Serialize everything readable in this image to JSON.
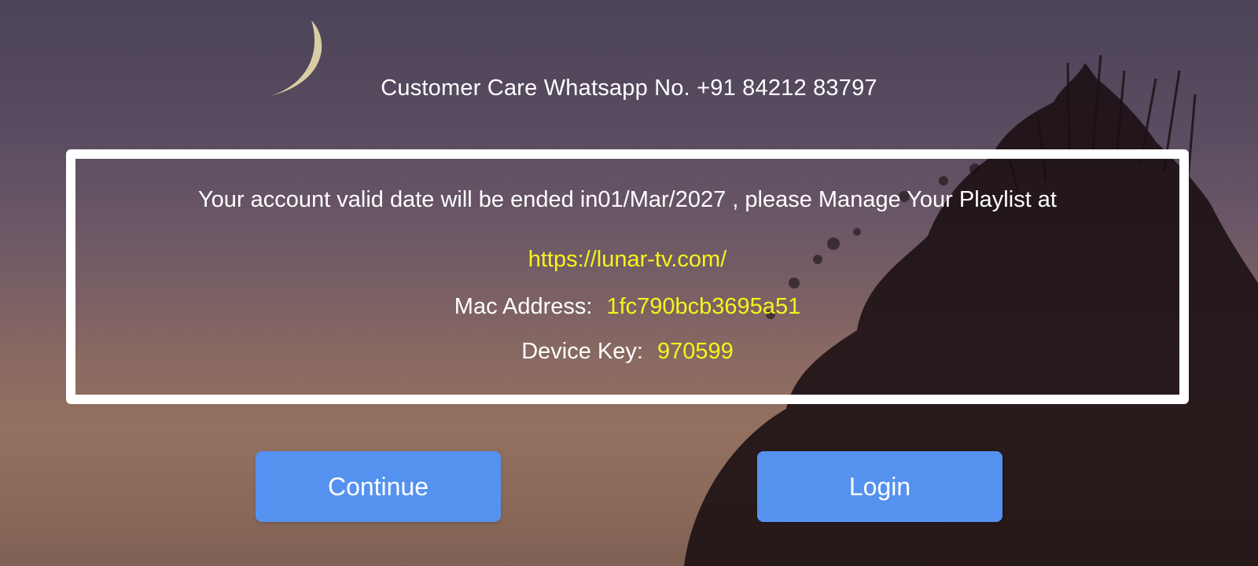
{
  "header": {
    "customer_care": "Customer Care Whatsapp No. +91 84212 83797"
  },
  "info": {
    "validity_text": "Your account valid date will be ended in01/Mar/2027 , please Manage Your Playlist at",
    "url": "https://lunar-tv.com/",
    "mac_label": "Mac Address:",
    "mac_value": "1fc790bcb3695a51",
    "device_key_label": "Device Key:",
    "device_key_value": "970599"
  },
  "buttons": {
    "continue_label": "Continue",
    "login_label": "Login"
  },
  "colors": {
    "accent_button": "#5592f0",
    "highlight_text": "#f5f51a",
    "text": "#ffffff"
  },
  "icons": {
    "moon": "crescent-moon-decoration"
  }
}
